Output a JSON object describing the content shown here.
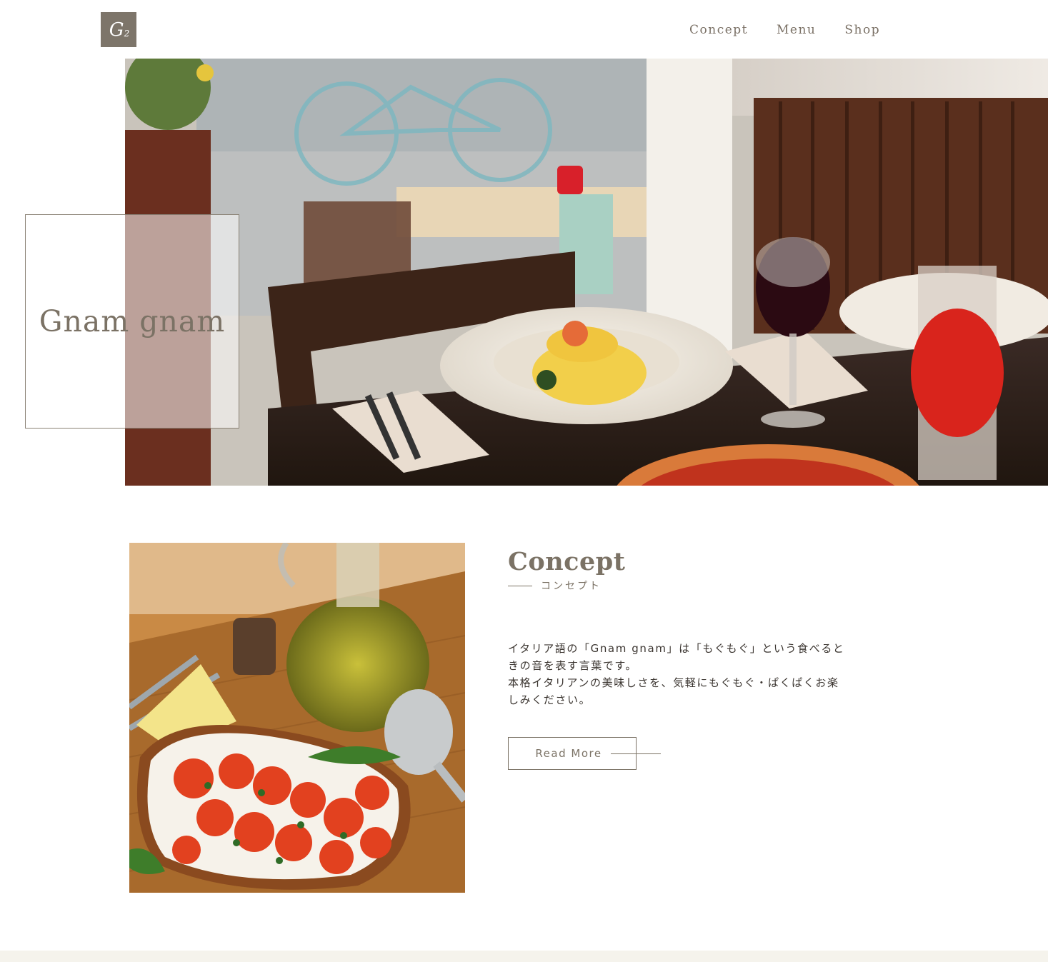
{
  "header": {
    "logo_text": "G",
    "logo_sub": "2",
    "nav": [
      {
        "label": "Concept"
      },
      {
        "label": "Menu"
      },
      {
        "label": "Shop"
      }
    ]
  },
  "hero": {
    "title": "Gnam gnam"
  },
  "concept": {
    "heading": "Concept",
    "subheading": "コンセプト",
    "paragraph_1": "イタリア語の「Gnam gnam」は「もぐもぐ」という食べるときの音を表す言葉です。",
    "paragraph_2": "本格イタリアンの美味しさを、気軽にもぐもぐ・ぱくぱくお楽しみください。",
    "read_more_label": "Read More"
  },
  "colors": {
    "brand": "#7d756a",
    "text": "#7b7265",
    "body_text": "#3b3530",
    "footer_band": "#f5f3ec"
  }
}
